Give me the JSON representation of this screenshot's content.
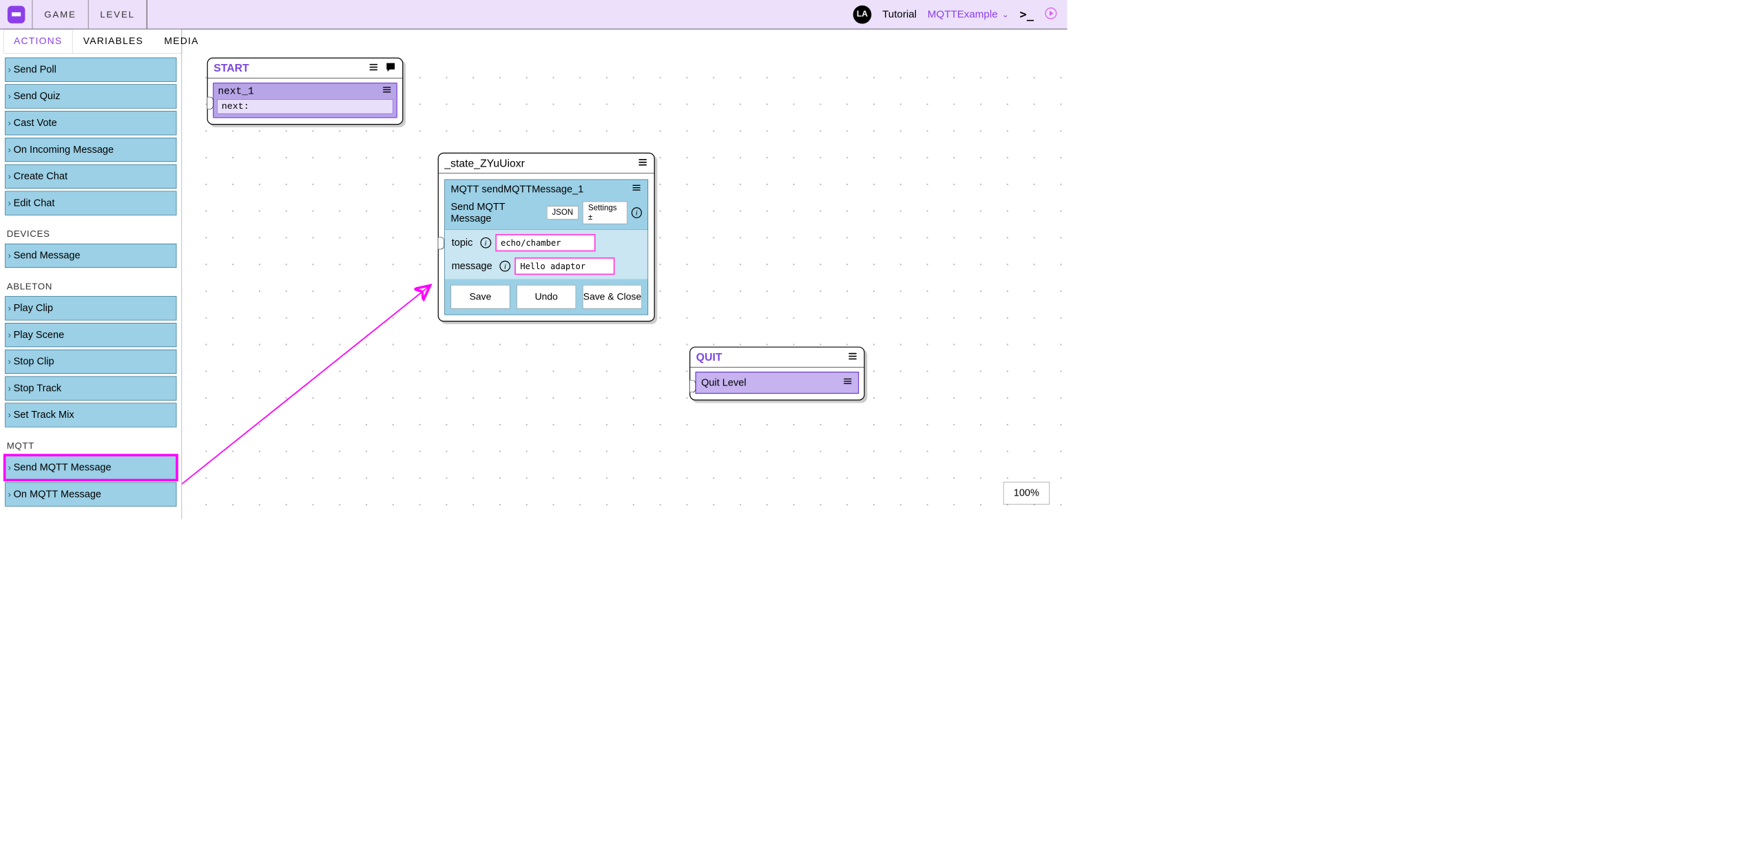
{
  "topbar": {
    "menu_game": "GAME",
    "menu_level": "LEVEL",
    "avatar_initials": "LA",
    "link_tutorial": "Tutorial",
    "project_name": "MQTTExample",
    "terminal_glyph": ">_"
  },
  "tabs": {
    "actions": "ACTIONS",
    "variables": "VARIABLES",
    "media": "MEDIA"
  },
  "sidebar": {
    "items_top": [
      "Send Poll",
      "Send Quiz",
      "Cast Vote",
      "On Incoming Message",
      "Create Chat",
      "Edit Chat"
    ],
    "cat_devices": "DEVICES",
    "items_devices": [
      "Send Message"
    ],
    "cat_ableton": "ABLETON",
    "items_ableton": [
      "Play Clip",
      "Play Scene",
      "Stop Clip",
      "Stop Track",
      "Set Track Mix"
    ],
    "cat_mqtt": "MQTT",
    "items_mqtt": [
      "Send MQTT Message",
      "On MQTT Message"
    ]
  },
  "nodes": {
    "start": {
      "title": "START",
      "slot_label": "next_1",
      "slot_sub": "next:"
    },
    "state": {
      "title": "_state_ZYuUioxr",
      "block_title": "MQTT sendMQTTMessage_1",
      "subtitle": "Send MQTT Message",
      "json_btn": "JSON",
      "settings_btn": "Settings ±",
      "field_topic_label": "topic",
      "field_topic_value": "echo/chamber",
      "field_message_label": "message",
      "field_message_value": "Hello adaptor",
      "save": "Save",
      "undo": "Undo",
      "saveclose": "Save & Close"
    },
    "quit": {
      "title": "QUIT",
      "slot_label": "Quit Level"
    }
  },
  "zoom": "100%"
}
